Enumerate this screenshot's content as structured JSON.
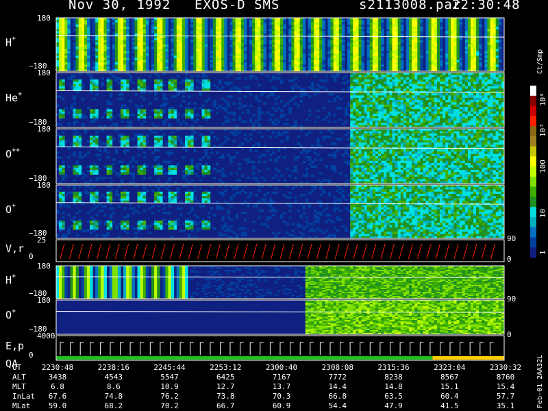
{
  "header": {
    "date": "Nov 30, 1992",
    "instrument": "EXOS-D SMS",
    "file": "s2113008.par",
    "time": "22:30:48"
  },
  "panels": [
    {
      "label": "H",
      "sup": "+",
      "ymax": "180",
      "ymin": "−180"
    },
    {
      "label": "He",
      "sup": "+",
      "ymax": "180",
      "ymin": "−180"
    },
    {
      "label": "O",
      "sup": "++",
      "ymax": "180",
      "ymin": "−180"
    },
    {
      "label": "O",
      "sup": "+",
      "ymax": "180",
      "ymin": "−180"
    },
    {
      "label": "V,r",
      "ymax": "25",
      "ymin": "0",
      "right": "90",
      "right2": "0"
    },
    {
      "label": "H",
      "sup": "+",
      "ymax": "180",
      "ymin": "−180"
    },
    {
      "label": "O",
      "sup": "+",
      "ymax": "180",
      "ymin": "−180",
      "right": "90"
    },
    {
      "label": "E,p",
      "label2": "QA",
      "ymax": "4000",
      "ymin": "0",
      "right": "0"
    }
  ],
  "colorbar": {
    "unit": "Ct/Smp",
    "ticks": [
      "10⁴",
      "10³",
      "100",
      "10",
      "1"
    ],
    "colors": [
      "#ffffff",
      "#8b0000",
      "#cc0000",
      "#ff2000",
      "#8b6914",
      "#a08020",
      "#c8c800",
      "#ffff00",
      "#c0ff00",
      "#80e000",
      "#40b000",
      "#209020",
      "#00e0e0",
      "#00b0c0",
      "#0070c0",
      "#0040a0",
      "#102080"
    ]
  },
  "side_text": "Feb-01 2AA32L",
  "table": {
    "rows": [
      {
        "label": "UT",
        "values": [
          "2230:48",
          "2238:16",
          "2245:44",
          "2253:12",
          "2300:40",
          "2308:08",
          "2315:36",
          "2323:04",
          "2330:32"
        ]
      },
      {
        "label": "ALT",
        "values": [
          "3438",
          "4543",
          "5547",
          "6425",
          "7167",
          "7772",
          "8238",
          "8567",
          "8760"
        ]
      },
      {
        "label": "MLT",
        "values": [
          "6.8",
          "8.6",
          "10.9",
          "12.7",
          "13.7",
          "14.4",
          "14.8",
          "15.1",
          "15.4"
        ]
      },
      {
        "label": "InLat",
        "values": [
          "67.6",
          "74.8",
          "76.2",
          "73.8",
          "70.3",
          "66.8",
          "63.5",
          "60.4",
          "57.7"
        ]
      },
      {
        "label": "MLat",
        "values": [
          "59.0",
          "68.2",
          "70.2",
          "66.7",
          "60.9",
          "54.4",
          "47.9",
          "41.5",
          "35.1"
        ]
      }
    ]
  },
  "chart_data": {
    "type": "heatmap",
    "title": "Nov 30, 1992   EXOS-D SMS",
    "xlabel": "UT",
    "x_ticks": [
      "2230:48",
      "2238:16",
      "2245:44",
      "2253:12",
      "2300:40",
      "2308:08",
      "2315:36",
      "2323:04",
      "2330:32"
    ],
    "ylim": [
      -180,
      180
    ],
    "color_scale": "log",
    "color_range": [
      1,
      10000
    ],
    "colorbar_label": "Ct/Smp",
    "series": [
      {
        "name": "H+",
        "ylim": [
          -180,
          180
        ]
      },
      {
        "name": "He+",
        "ylim": [
          -180,
          180
        ]
      },
      {
        "name": "O++",
        "ylim": [
          -180,
          180
        ]
      },
      {
        "name": "O+",
        "ylim": [
          -180,
          180
        ]
      },
      {
        "name": "V,r",
        "ylim": [
          0,
          25
        ]
      },
      {
        "name": "H+",
        "ylim": [
          -180,
          180
        ]
      },
      {
        "name": "O+",
        "ylim": [
          -180,
          180
        ]
      },
      {
        "name": "E,p",
        "ylim": [
          0,
          4000
        ]
      }
    ]
  }
}
